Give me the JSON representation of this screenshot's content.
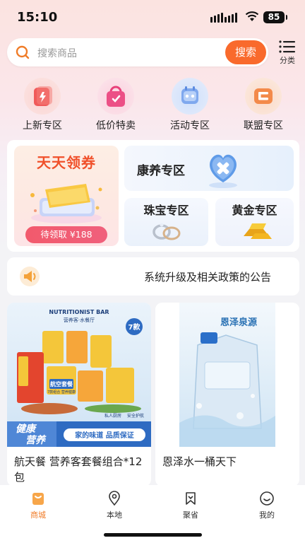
{
  "status": {
    "time": "15:10",
    "battery": "85"
  },
  "search": {
    "placeholder": "搜索商品",
    "button_label": "搜索"
  },
  "category": {
    "label": "分类"
  },
  "quick_nav": [
    {
      "label": "上新专区",
      "icon": "new-arrival-bag-icon"
    },
    {
      "label": "低价特卖",
      "icon": "shopping-bag-icon"
    },
    {
      "label": "活动专区",
      "icon": "activity-calendar-icon"
    },
    {
      "label": "联盟专区",
      "icon": "alliance-icon"
    }
  ],
  "promo": {
    "coupon_title": "天天领券",
    "coupon_pending": "待领取 ¥188",
    "health_zone": "康养专区",
    "jewelry_zone": "珠宝专区",
    "gold_zone": "黄金专区"
  },
  "notice": {
    "text": "系统升级及相关政策的公告"
  },
  "products": [
    {
      "name": "航天餐 营养客套餐组合*12包",
      "image_text": {
        "brand": "NUTRITIONIST BAR",
        "subbrand": "营养客·水餐厅",
        "badge": "7款",
        "package": "航空套餐",
        "package_sub": "7款组合 营养健康",
        "tag1": "私人厨房",
        "tag2": "安全护航",
        "slogan1": "健康",
        "slogan2": "营养",
        "bottom": "家的味道  品质保证"
      }
    },
    {
      "name": "恩泽水一桶天下",
      "image_text": {
        "brand": "恩泽泉源"
      }
    }
  ],
  "tabbar": [
    {
      "label": "商城",
      "icon": "shop-bag-icon",
      "active": true
    },
    {
      "label": "本地",
      "icon": "location-pin-icon",
      "active": false
    },
    {
      "label": "聚省",
      "icon": "bookmark-icon",
      "active": false
    },
    {
      "label": "我的",
      "icon": "smile-face-icon",
      "active": false
    }
  ],
  "colors": {
    "accent": "#f96a2c",
    "tab_active": "#f07c28",
    "coupon_red": "#f0502a"
  }
}
